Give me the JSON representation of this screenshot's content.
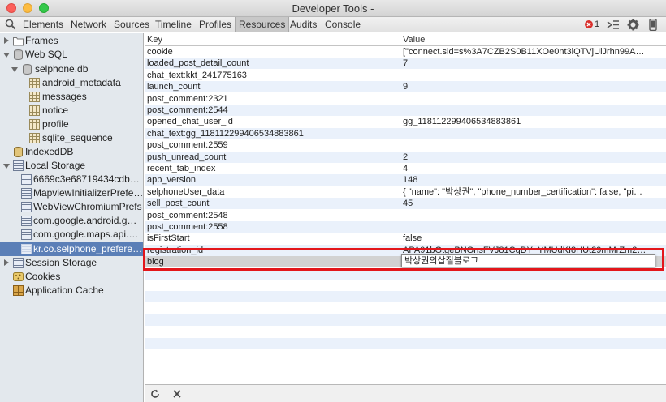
{
  "window": {
    "title": "Developer Tools -"
  },
  "toolbar": {
    "tabs": [
      "Elements",
      "Network",
      "Sources",
      "Timeline",
      "Profiles",
      "Resources",
      "Audits",
      "Console"
    ],
    "selected_tab": "Resources",
    "error_count": "1"
  },
  "sidebar": {
    "items": [
      {
        "label": "Frames",
        "icon": "folder-icon"
      },
      {
        "label": "Web SQL",
        "icon": "database-icon"
      },
      {
        "label": "selphone.db",
        "icon": "database-icon"
      },
      {
        "label": "android_metadata",
        "icon": "table-icon"
      },
      {
        "label": "messages",
        "icon": "table-icon"
      },
      {
        "label": "notice",
        "icon": "table-icon"
      },
      {
        "label": "profile",
        "icon": "table-icon"
      },
      {
        "label": "sqlite_sequence",
        "icon": "table-icon"
      },
      {
        "label": "IndexedDB",
        "icon": "database-icon"
      },
      {
        "label": "Local Storage",
        "icon": "storage-icon"
      },
      {
        "label": "6669c3e68719434cdb…",
        "icon": "storage-icon"
      },
      {
        "label": "MapviewInitializerPrefe…",
        "icon": "storage-icon"
      },
      {
        "label": "WebViewChromiumPrefs",
        "icon": "storage-icon"
      },
      {
        "label": "com.google.android.g…",
        "icon": "storage-icon"
      },
      {
        "label": "com.google.maps.api.…",
        "icon": "storage-icon"
      },
      {
        "label": "kr.co.selphone_prefere…",
        "icon": "storage-icon"
      },
      {
        "label": "Session Storage",
        "icon": "storage-icon"
      },
      {
        "label": "Cookies",
        "icon": "cookie-icon"
      },
      {
        "label": "Application Cache",
        "icon": "cache-icon"
      }
    ]
  },
  "table": {
    "columns": [
      "Key",
      "Value"
    ],
    "rows": [
      [
        "cookie",
        "[\"connect.sid=s%3A7CZB2S0B11XOe0nt3lQTVjUlJrhn99Ax.klf…"
      ],
      [
        "loaded_post_detail_count",
        "7"
      ],
      [
        "chat_text:kkt_241775163",
        ""
      ],
      [
        "launch_count",
        "9"
      ],
      [
        "post_comment:2321",
        ""
      ],
      [
        "post_comment:2544",
        ""
      ],
      [
        "opened_chat_user_id",
        "gg_118112299406534883861"
      ],
      [
        "chat_text:gg_118112299406534883861",
        ""
      ],
      [
        "post_comment:2559",
        ""
      ],
      [
        "push_unread_count",
        "2"
      ],
      [
        "recent_tab_index",
        "4"
      ],
      [
        "app_version",
        "148"
      ],
      [
        "selphoneUser_data",
        "{ \"name\": \"박상권\", \"phone_number_certification\": false, \"pictur…"
      ],
      [
        "sell_post_count",
        "45"
      ],
      [
        "post_comment:2548",
        ""
      ],
      [
        "post_comment:2558",
        ""
      ],
      [
        "isFirstStart",
        "false"
      ],
      [
        "registration_id",
        "APA91bGtgeBNGnsFVJ81CqDY_YMUdKI8HUt29mMrZm2OdW…"
      ],
      [
        "blog",
        ""
      ]
    ],
    "editing_value": "박상권의삽질블로그"
  }
}
